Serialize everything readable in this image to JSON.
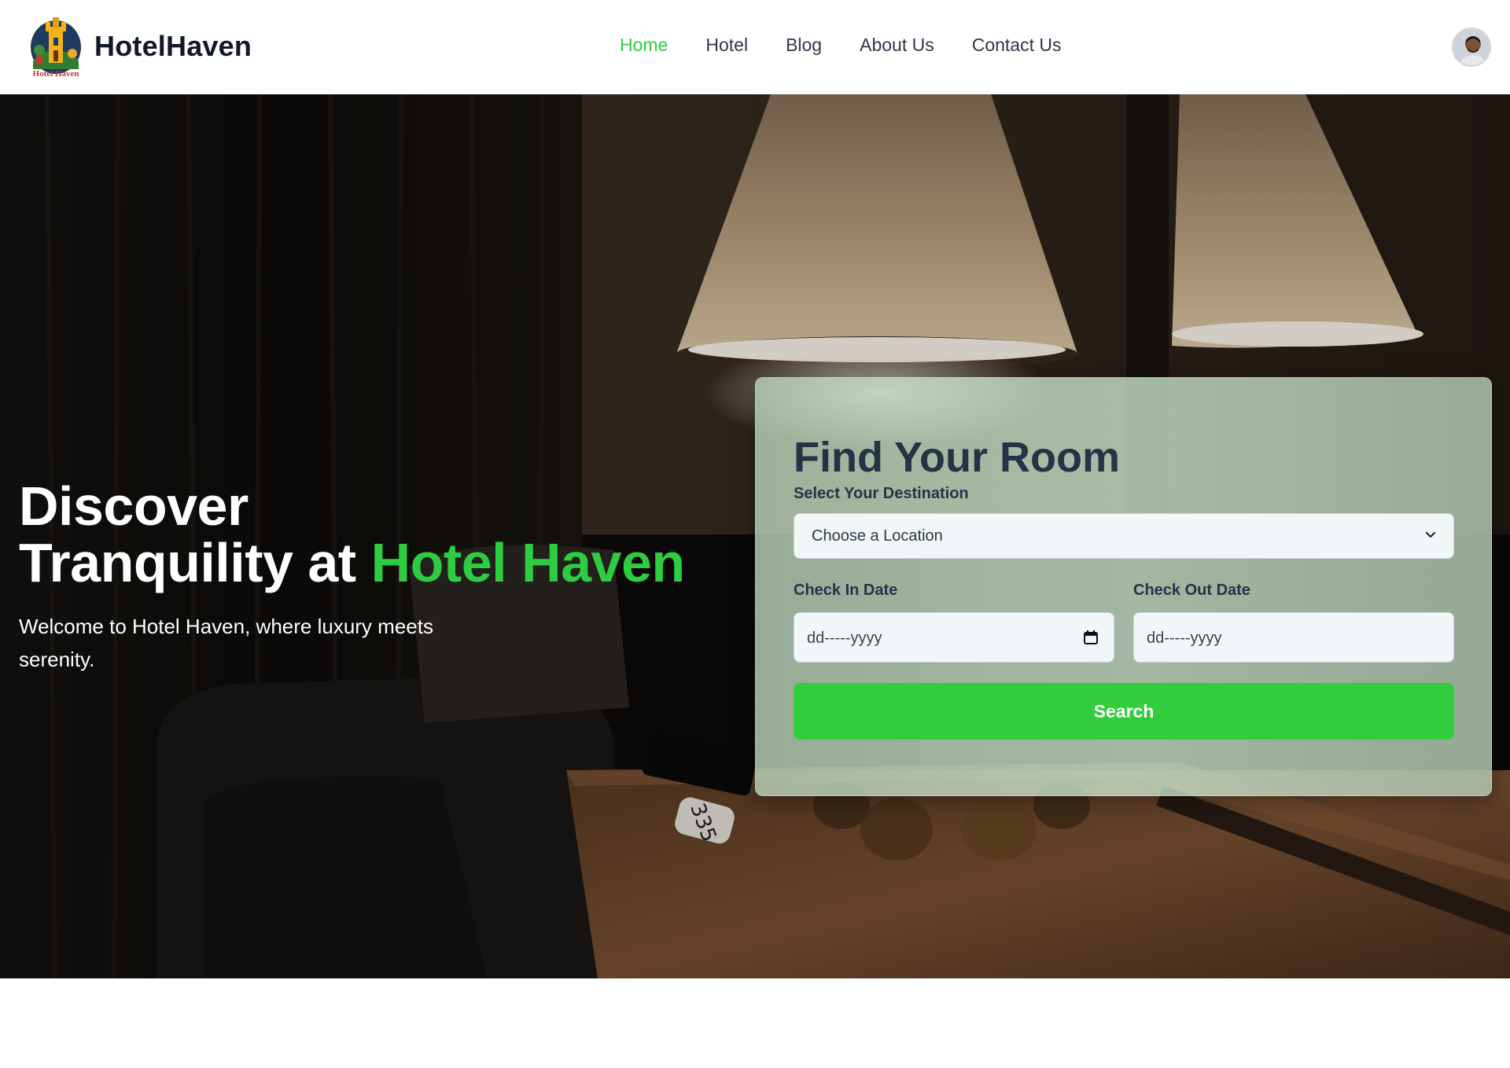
{
  "brand": {
    "name": "HotelHaven",
    "logo_caption": "Hotel Haven"
  },
  "nav": {
    "items": [
      {
        "label": "Home",
        "active": true
      },
      {
        "label": "Hotel",
        "active": false
      },
      {
        "label": "Blog",
        "active": false
      },
      {
        "label": "About Us",
        "active": false
      },
      {
        "label": "Contact Us",
        "active": false
      }
    ]
  },
  "user": {
    "avatar_icon": "user-avatar"
  },
  "hero": {
    "title_line1": "Discover",
    "title_line2_prefix": "Tranquility at ",
    "title_highlight": "Hotel Haven",
    "subtitle": "Welcome to Hotel Haven, where luxury meets serenity.",
    "room_tag": "335"
  },
  "search": {
    "title": "Find Your Room",
    "destination_label": "Select Your Destination",
    "destination_value": "Choose a Location",
    "check_in_label": "Check In Date",
    "check_in_value": "dd-----yyyy",
    "check_out_label": "Check Out Date",
    "check_out_value": "dd-----yyyy",
    "button_label": "Search"
  },
  "colors": {
    "accent": "#2ecc40",
    "button": "#33cc3c",
    "text_dark": "#243447"
  }
}
